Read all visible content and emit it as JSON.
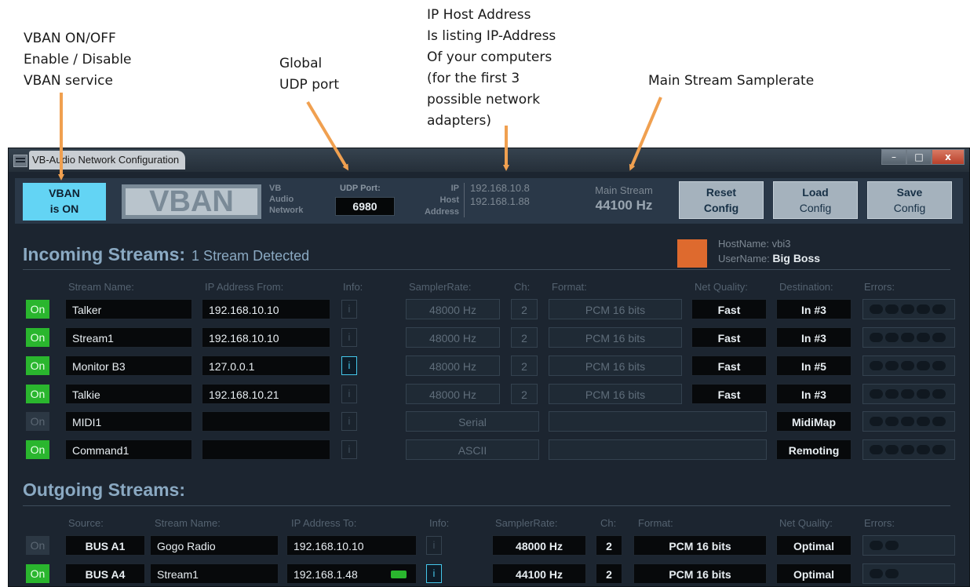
{
  "annotations": {
    "vban_onoff": [
      "VBAN ON/OFF",
      "Enable / Disable",
      "VBAN service"
    ],
    "udp": [
      "Global",
      "UDP port"
    ],
    "ip_host": [
      "IP Host Address",
      "Is listing IP-Address",
      "Of your computers",
      "(for the first 3",
      "possible network",
      "adapters)"
    ],
    "samplerate": [
      "Main Stream Samplerate"
    ]
  },
  "window": {
    "title": "VB-Audio Network Configuration",
    "controls": {
      "minimize": "–",
      "maximize": "□",
      "close": "x"
    }
  },
  "toolbar": {
    "vban_button": [
      "VBAN",
      "is ON"
    ],
    "logo_text": "VBAN",
    "logo_sub": [
      "VB",
      "Audio",
      "Network"
    ],
    "udp_label": "UDP Port:",
    "udp_value": "6980",
    "ip_label": [
      "IP",
      "Host",
      "Address"
    ],
    "ip_values": [
      "192.168.10.8",
      "192.168.1.88"
    ],
    "main_stream_label": "Main Stream",
    "main_stream_value": "44100 Hz",
    "reset": [
      "Reset",
      "Config"
    ],
    "load": [
      "Load",
      "Config"
    ],
    "save": [
      "Save",
      "Config"
    ]
  },
  "host": {
    "hostname_label": "HostName:",
    "hostname": "vbi3",
    "username_label": "UserName:",
    "username": "Big Boss",
    "color": "#de6a2e"
  },
  "incoming": {
    "title": "Incoming Streams:",
    "subtitle": "1 Stream Detected",
    "headers": {
      "stream_name": "Stream Name:",
      "ip_from": "IP Address From:",
      "info": "Info:",
      "samplerate": "SamplerRate:",
      "ch": "Ch:",
      "format": "Format:",
      "net_quality": "Net Quality:",
      "destination": "Destination:",
      "errors": "Errors:"
    },
    "rows": [
      {
        "state": "On",
        "enabled": true,
        "name": "Talker",
        "ip": "192.168.10.10",
        "info_active": false,
        "rate": "48000 Hz",
        "ch": "2",
        "format": "PCM 16 bits",
        "quality": "Fast",
        "dest": "In #3"
      },
      {
        "state": "On",
        "enabled": true,
        "name": "Stream1",
        "ip": "192.168.10.10",
        "info_active": false,
        "rate": "48000 Hz",
        "ch": "2",
        "format": "PCM 16 bits",
        "quality": "Fast",
        "dest": "In #3"
      },
      {
        "state": "On",
        "enabled": true,
        "name": "Monitor B3",
        "ip": "127.0.0.1",
        "info_active": true,
        "rate": "48000 Hz",
        "ch": "2",
        "format": "PCM 16 bits",
        "quality": "Fast",
        "dest": "In #5"
      },
      {
        "state": "On",
        "enabled": true,
        "name": "Talkie",
        "ip": "192.168.10.21",
        "info_active": false,
        "rate": "48000 Hz",
        "ch": "2",
        "format": "PCM 16 bits",
        "quality": "Fast",
        "dest": "In #3"
      },
      {
        "state": "On",
        "enabled": false,
        "name": "MIDI1",
        "ip": "",
        "info_active": false,
        "rate": "Serial",
        "dest": "MidiMap"
      },
      {
        "state": "On",
        "enabled": true,
        "name": "Command1",
        "ip": "",
        "info_active": false,
        "rate": "ASCII",
        "dest": "Remoting"
      }
    ]
  },
  "outgoing": {
    "title": "Outgoing Streams:",
    "headers": {
      "source": "Source:",
      "stream_name": "Stream Name:",
      "ip_to": "IP Address To:",
      "info": "Info:",
      "samplerate": "SamplerRate:",
      "ch": "Ch:",
      "format": "Format:",
      "net_quality": "Net Quality:",
      "errors": "Errors:"
    },
    "rows": [
      {
        "state": "On",
        "enabled": false,
        "source": "BUS A1",
        "name": "Gogo Radio",
        "ip": "192.168.10.10",
        "info_active": false,
        "rate": "48000 Hz",
        "ch": "2",
        "format": "PCM 16 bits",
        "quality": "Optimal"
      },
      {
        "state": "On",
        "enabled": true,
        "source": "BUS A4",
        "name": "Stream1",
        "ip": "192.168.1.48",
        "info_active": true,
        "rate": "44100 Hz",
        "ch": "2",
        "format": "PCM 16 bits",
        "quality": "Optimal"
      }
    ]
  },
  "colors": {
    "accent": "#63d4f4",
    "on_green": "#2ab62e",
    "arrow": "#f0a050",
    "section_title": "#8aa9c2"
  }
}
